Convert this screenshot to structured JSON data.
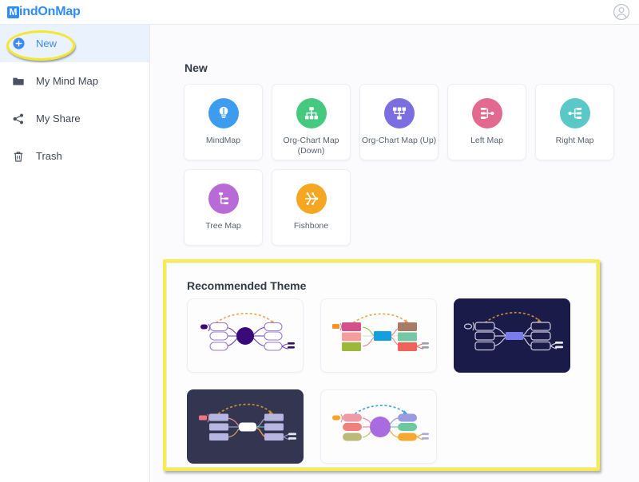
{
  "header": {
    "logo_mark": "M",
    "logo_text": "indOnMap",
    "avatar_icon": "user-avatar-icon"
  },
  "sidebar": {
    "items": [
      {
        "label": "New",
        "icon": "plus-circle-icon",
        "active": true
      },
      {
        "label": "My Mind Map",
        "icon": "folder-icon",
        "active": false
      },
      {
        "label": "My Share",
        "icon": "share-nodes-icon",
        "active": false
      },
      {
        "label": "Trash",
        "icon": "trash-icon",
        "active": false
      }
    ]
  },
  "main": {
    "new_section": {
      "title": "New",
      "cards": [
        {
          "label": "MindMap",
          "icon": "lightbulb-icon",
          "color": "#3d9bf0"
        },
        {
          "label": "Org-Chart Map (Down)",
          "icon": "org-chart-down-icon",
          "color": "#45c97f"
        },
        {
          "label": "Org-Chart Map (Up)",
          "icon": "org-chart-up-icon",
          "color": "#7b6fe0"
        },
        {
          "label": "Left Map",
          "icon": "left-map-icon",
          "color": "#e2698f"
        },
        {
          "label": "Right Map",
          "icon": "right-map-icon",
          "color": "#5bc8c8"
        },
        {
          "label": "Tree Map",
          "icon": "tree-map-icon",
          "color": "#b86bd6"
        },
        {
          "label": "Fishbone",
          "icon": "fishbone-icon",
          "color": "#f5a623"
        }
      ]
    },
    "theme_section": {
      "title": "Recommended Theme",
      "themes": [
        {
          "name": "theme-purple-light",
          "style": "light",
          "accent": "#3b0a7a"
        },
        {
          "name": "theme-colorful-rect",
          "style": "light",
          "accent": "#159ee0"
        },
        {
          "name": "theme-midnight-blue",
          "style": "dark",
          "accent": "#7b7bf0"
        },
        {
          "name": "theme-dark-slate",
          "style": "dark2",
          "accent": "#ffffff"
        },
        {
          "name": "theme-pastel-round",
          "style": "light",
          "accent": "#a96be0"
        }
      ]
    }
  },
  "annotations": {
    "highlight_color": "#f7ed4e",
    "new_button_ellipse": "New",
    "theme_box_outline": "Recommended Theme"
  }
}
